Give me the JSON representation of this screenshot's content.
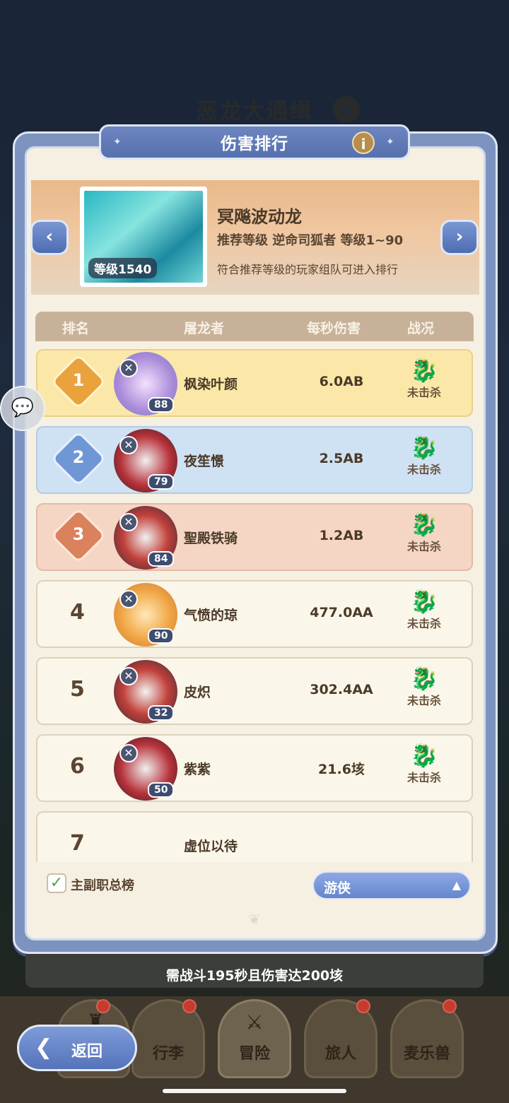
{
  "background": {
    "title": "恶龙大通缉"
  },
  "dialog": {
    "title": "伤害排行",
    "info_icon": "i"
  },
  "boss": {
    "name": "冥飚波动龙",
    "level_badge": "等级1540",
    "recommend": "推荐等级 逆命司狐者  等级1~90",
    "note": "符合推荐等级的玩家组队可进入排行"
  },
  "table": {
    "headers": {
      "rank": "排名",
      "player": "屠龙者",
      "dps": "每秒伤害",
      "status": "战况"
    },
    "rows": [
      {
        "rank": "1",
        "name": "枫染叶颜",
        "level": "88",
        "dps": "6.0AB",
        "status": "未击杀"
      },
      {
        "rank": "2",
        "name": "夜笙憬",
        "level": "79",
        "dps": "2.5AB",
        "status": "未击杀"
      },
      {
        "rank": "3",
        "name": "聖殿铁骑",
        "level": "84",
        "dps": "1.2AB",
        "status": "未击杀"
      },
      {
        "rank": "4",
        "name": "气愤的琼",
        "level": "90",
        "dps": "477.0AA",
        "status": "未击杀"
      },
      {
        "rank": "5",
        "name": "皮炽",
        "level": "32",
        "dps": "302.4AA",
        "status": "未击杀"
      },
      {
        "rank": "6",
        "name": "紫紫",
        "level": "50",
        "dps": "21.6垓",
        "status": "未击杀"
      },
      {
        "rank": "7",
        "name": "虚位以待"
      }
    ]
  },
  "filter": {
    "checkbox_label": "主副职总榜",
    "checked_mark": "✓",
    "class_select": "游侠"
  },
  "requirement": "需战斗195秒且伤害达200垓",
  "nav": {
    "tabs": [
      "行李",
      "冒险",
      "旅人",
      "麦乐兽"
    ],
    "back": "返回"
  },
  "icons": {
    "status": "dragon-icon",
    "medal_colors": [
      "#e9a23c",
      "#6f97d6",
      "#d9825c"
    ]
  }
}
